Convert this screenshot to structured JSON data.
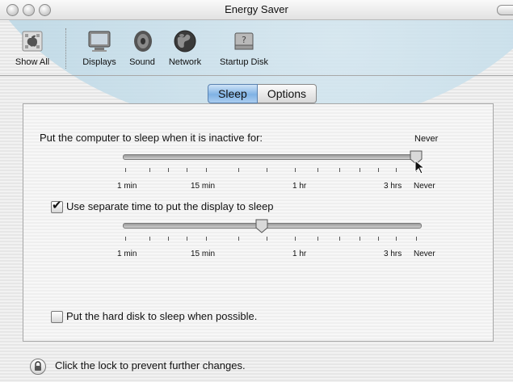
{
  "window": {
    "title": "Energy Saver"
  },
  "toolbar": {
    "items": [
      {
        "label": "Show All",
        "icon": "apple-grid-icon"
      },
      {
        "label": "Displays",
        "icon": "display-icon"
      },
      {
        "label": "Sound",
        "icon": "speaker-icon"
      },
      {
        "label": "Network",
        "icon": "globe-icon"
      },
      {
        "label": "Startup Disk",
        "icon": "hard-disk-icon"
      }
    ]
  },
  "tabs": [
    {
      "label": "Sleep",
      "selected": true
    },
    {
      "label": "Options",
      "selected": false
    }
  ],
  "sleep": {
    "computer_label": "Put the computer to sleep when it is inactive for:",
    "computer_value": "Never",
    "computer_slider_fraction": 1.0,
    "tick_labels": {
      "one_min": "1 min",
      "fifteen_min": "15 min",
      "one_hr": "1 hr",
      "three_hrs": "3 hrs",
      "never": "Never"
    },
    "display_checkbox_label": "Use separate time to put the display to sleep",
    "display_checkbox_checked": true,
    "display_slider_fraction": 0.47,
    "disk_checkbox_label": "Put the hard disk to sleep when possible.",
    "disk_checkbox_checked": false
  },
  "footer": {
    "lock_text": "Click the lock to prevent further changes."
  },
  "colors": {
    "tab_selected": "#7fb2e4",
    "swoosh": "#bcd8e6"
  }
}
